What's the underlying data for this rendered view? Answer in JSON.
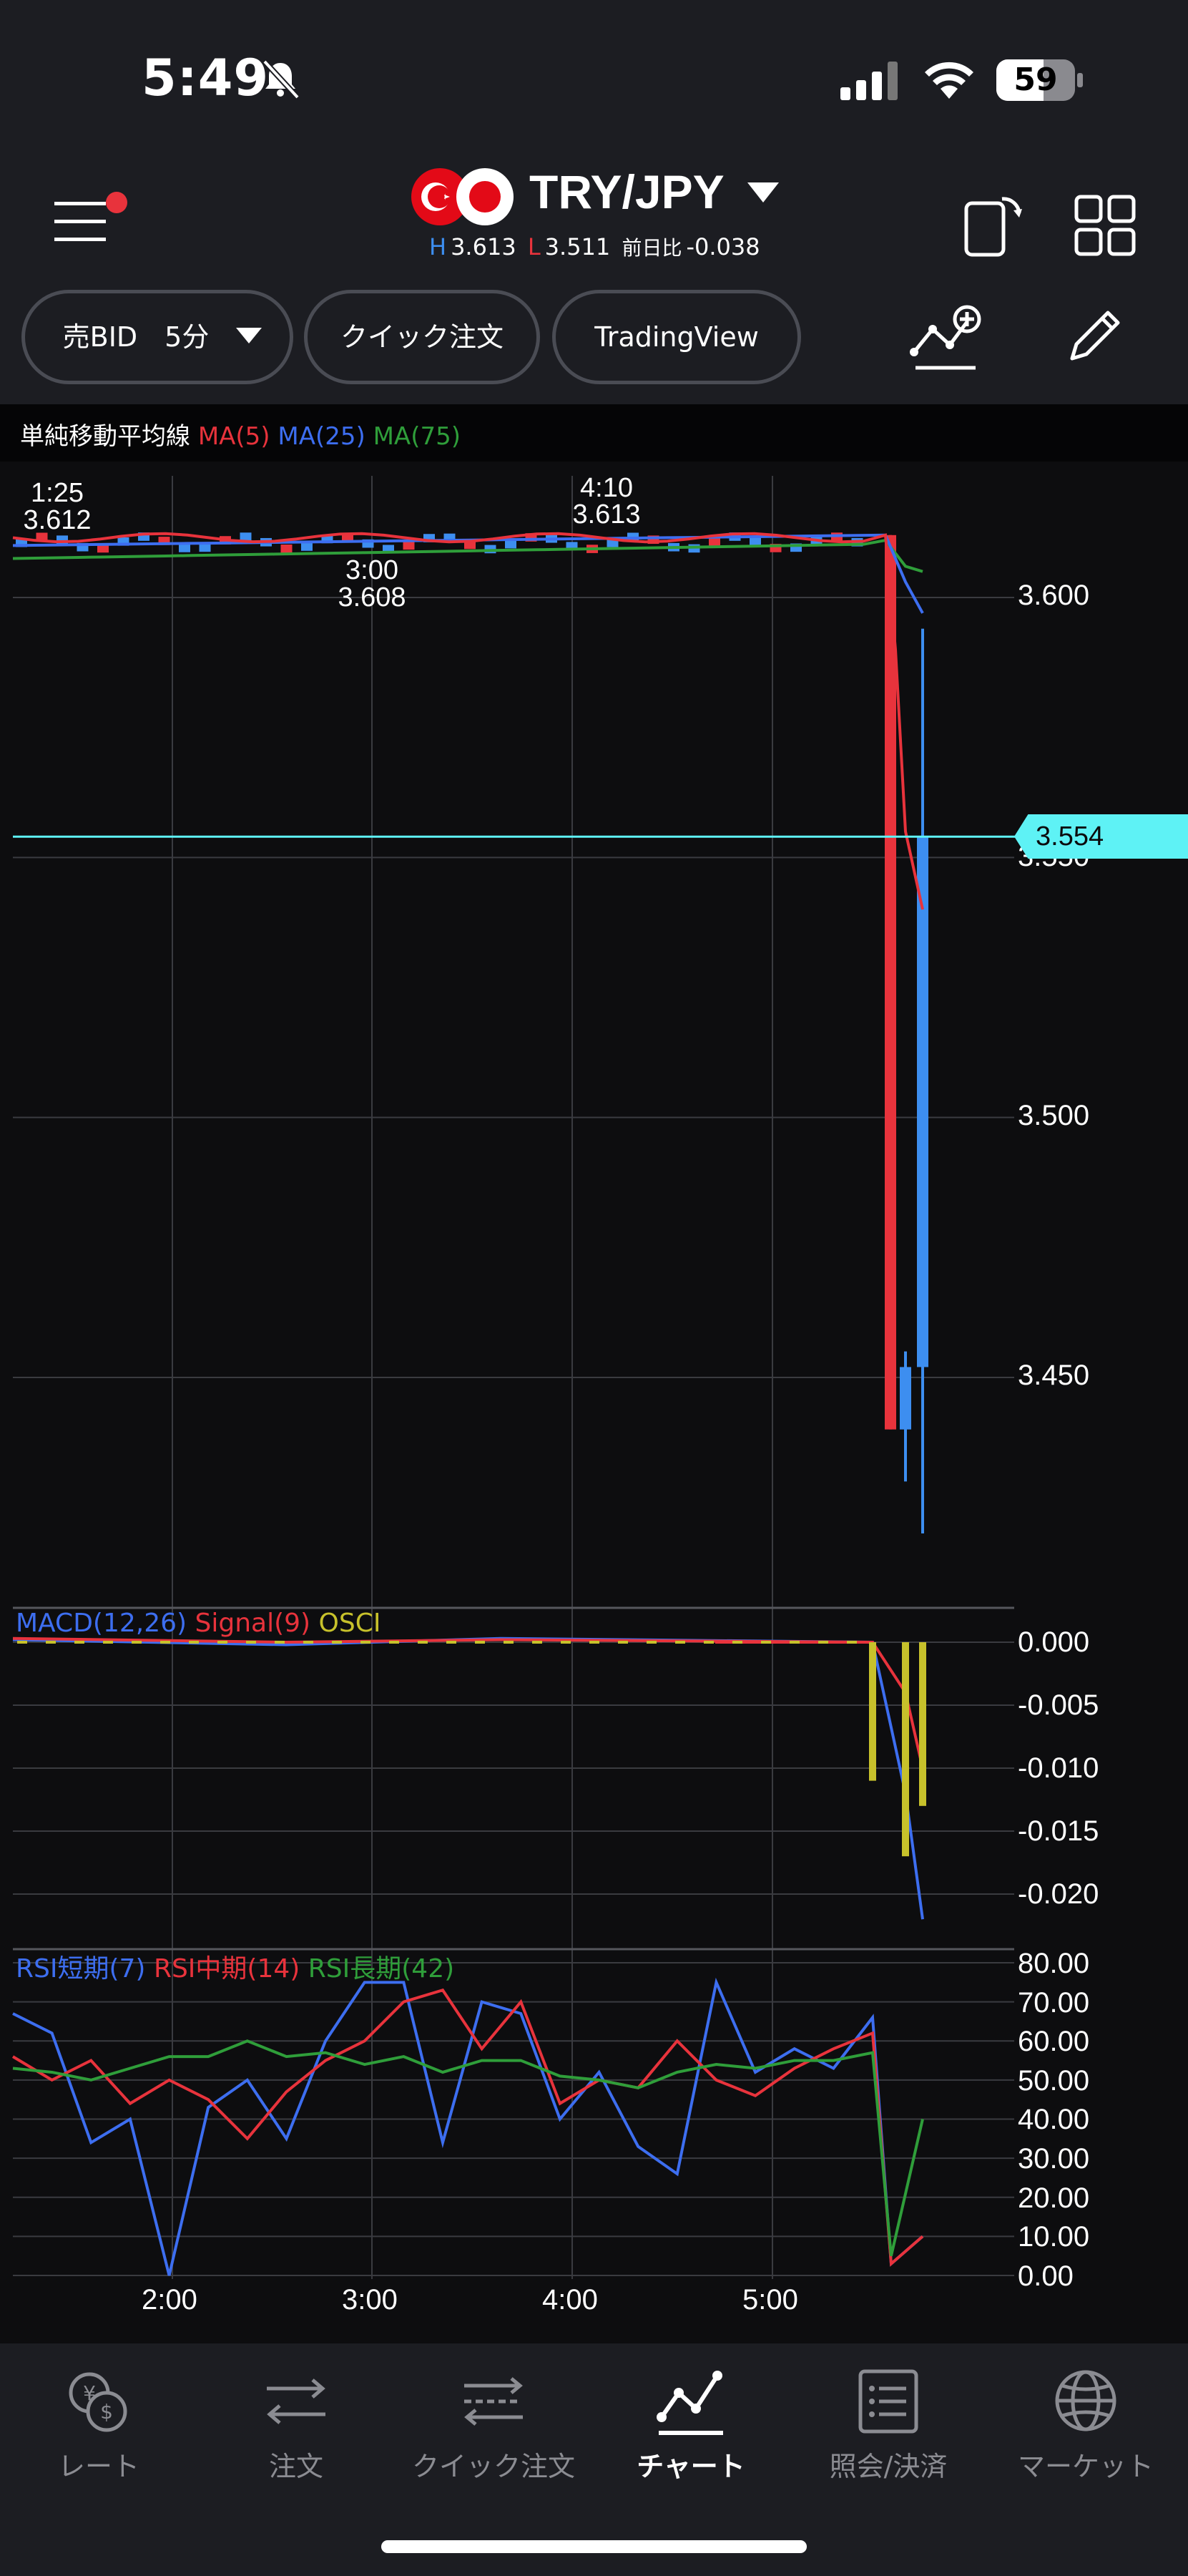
{
  "status": {
    "time": "5:49",
    "battery": "59"
  },
  "header": {
    "pair": "TRY/JPY",
    "high_label": "H",
    "high": "3.613",
    "low_label": "L",
    "low": "3.511",
    "change_label": "前日比",
    "change": "-0.038"
  },
  "toolbar": {
    "bid_label": "売BID　5分",
    "quick_order_label": "クイック注文",
    "tradingview_label": "TradingView"
  },
  "ma_legend": {
    "title": "単純移動平均線",
    "ma5": "MA(5)",
    "ma25": "MA(25)",
    "ma75": "MA(75)"
  },
  "price_axis": [
    "3.600",
    "3.550",
    "3.500",
    "3.450"
  ],
  "current_price": "3.554",
  "hilo_labels": [
    {
      "time": "1:25",
      "price": "3.612"
    },
    {
      "time": "4:10",
      "price": "3.613"
    },
    {
      "time": "3:00",
      "price": "3.608"
    }
  ],
  "macd_legend": {
    "macd": "MACD(12,26)",
    "signal": "Signal(9)",
    "osci": "OSCI"
  },
  "macd_axis": [
    "0.000",
    "-0.005",
    "-0.010",
    "-0.015",
    "-0.020"
  ],
  "rsi_legend": {
    "short": "RSI短期(7)",
    "mid": "RSI中期(14)",
    "long": "RSI長期(42)"
  },
  "rsi_axis": [
    "80.00",
    "70.00",
    "60.00",
    "50.00",
    "40.00",
    "30.00",
    "20.00",
    "10.00",
    "0.00"
  ],
  "time_axis": [
    "2:00",
    "3:00",
    "4:00",
    "5:00"
  ],
  "nav": [
    {
      "label": "レート",
      "icon": "rate-icon"
    },
    {
      "label": "注文",
      "icon": "order-icon"
    },
    {
      "label": "クイック注文",
      "icon": "quick-order-icon"
    },
    {
      "label": "チャート",
      "icon": "chart-icon",
      "active": true
    },
    {
      "label": "照会/決済",
      "icon": "inquiry-icon"
    },
    {
      "label": "マーケット",
      "icon": "globe-icon"
    }
  ],
  "colors": {
    "ma5": "#e8333c",
    "ma25": "#3d6ef0",
    "ma75": "#2f9e3a",
    "bull": "#3d8ef0",
    "bear": "#e8333c",
    "current_price": "#5ef2f5",
    "osci": "#c7c12b"
  },
  "chart_data": [
    {
      "type": "candlestick",
      "title": "TRY/JPY",
      "interval": "5分",
      "ylim": [
        3.43,
        3.62
      ],
      "current_price": 3.554,
      "candles_tail": [
        {
          "open": 3.612,
          "high": 3.612,
          "low": 3.44,
          "close": 3.44
        },
        {
          "open": 3.44,
          "high": 3.455,
          "low": 3.43,
          "close": 3.452
        },
        {
          "open": 3.452,
          "high": 3.594,
          "low": 3.42,
          "close": 3.554
        }
      ]
    },
    {
      "type": "line",
      "title": "MACD",
      "series": [
        {
          "name": "MACD(12,26)",
          "values": [
            0.0,
            0.0,
            0.0,
            -0.012,
            -0.022
          ]
        },
        {
          "name": "Signal(9)",
          "values": [
            0.0,
            0.0,
            0.0,
            -0.004,
            -0.01
          ]
        },
        {
          "name": "OSCI",
          "values": [
            0.0,
            0.0,
            -0.011,
            -0.017,
            -0.013
          ]
        }
      ],
      "ylim": [
        -0.022,
        0.0
      ]
    },
    {
      "type": "line",
      "title": "RSI",
      "series": [
        {
          "name": "RSI短期(7)",
          "values": [
            67,
            62,
            34,
            40,
            0,
            43,
            50,
            35,
            60,
            75,
            75,
            34,
            70,
            67,
            40,
            52,
            33,
            26,
            75,
            52,
            58,
            53,
            66,
            3,
            10
          ]
        },
        {
          "name": "RSI中期(14)",
          "values": [
            56,
            50,
            55,
            44,
            50,
            45,
            35,
            47,
            55,
            60,
            70,
            73,
            58,
            70,
            44,
            50,
            48,
            60,
            50,
            46,
            53,
            58,
            62,
            3,
            10
          ]
        },
        {
          "name": "RSI長期(42)",
          "values": [
            53,
            52,
            50,
            53,
            56,
            56,
            60,
            56,
            57,
            54,
            56,
            52,
            55,
            55,
            51,
            50,
            48,
            52,
            54,
            53,
            55,
            55,
            57,
            5,
            40
          ]
        }
      ],
      "ylim": [
        0,
        80
      ]
    }
  ]
}
